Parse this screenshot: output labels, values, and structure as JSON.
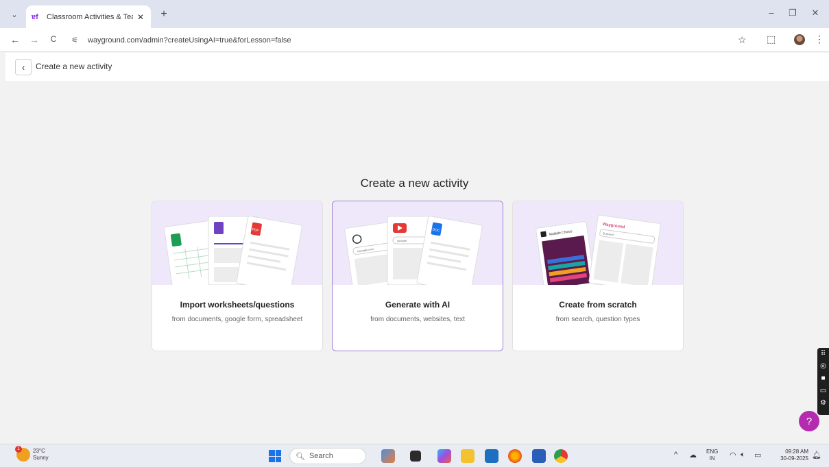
{
  "browser": {
    "tab_title": "Classroom Activities & Teachin",
    "tab_close": "✕",
    "new_tab": "+",
    "tab_list": "⌄",
    "url": "wayground.com/admin?createUsingAI=true&forLesson=false",
    "window_controls": {
      "minimize": "–",
      "restore": "❐",
      "close": "✕"
    },
    "nav": {
      "back": "←",
      "forward": "→",
      "reload": "C"
    }
  },
  "header": {
    "back_icon": "‹",
    "title": "Create a new activity"
  },
  "main": {
    "heading": "Create a new activity",
    "cards": [
      {
        "title": "Import worksheets/questions",
        "subtitle": "from documents, google form, spreadsheet",
        "selected": false
      },
      {
        "title": "Generate with AI",
        "subtitle": "from documents, websites, text",
        "selected": true
      },
      {
        "title": "Create from scratch",
        "subtitle": "from search, question types",
        "selected": false
      }
    ],
    "illustration_labels": {
      "pdf": "PDF",
      "doc": "DOC",
      "website": "example.com",
      "youtube": "youtube",
      "multiple_choice": "Multiple Choice",
      "brand": "Wayground",
      "search": "Q Search"
    }
  },
  "help": {
    "label": "?"
  },
  "taskbar": {
    "weather_temp": "23°C",
    "weather_desc": "Sunny",
    "weather_badge": "1",
    "search_label": "Search",
    "lang_line1": "ENG",
    "lang_line2": "IN",
    "time": "09:28 AM",
    "date": "30-09-2025"
  },
  "colors": {
    "accent": "#9c7fd6",
    "illustration_bg": "#efe8fb",
    "help": "#b52bb0"
  }
}
